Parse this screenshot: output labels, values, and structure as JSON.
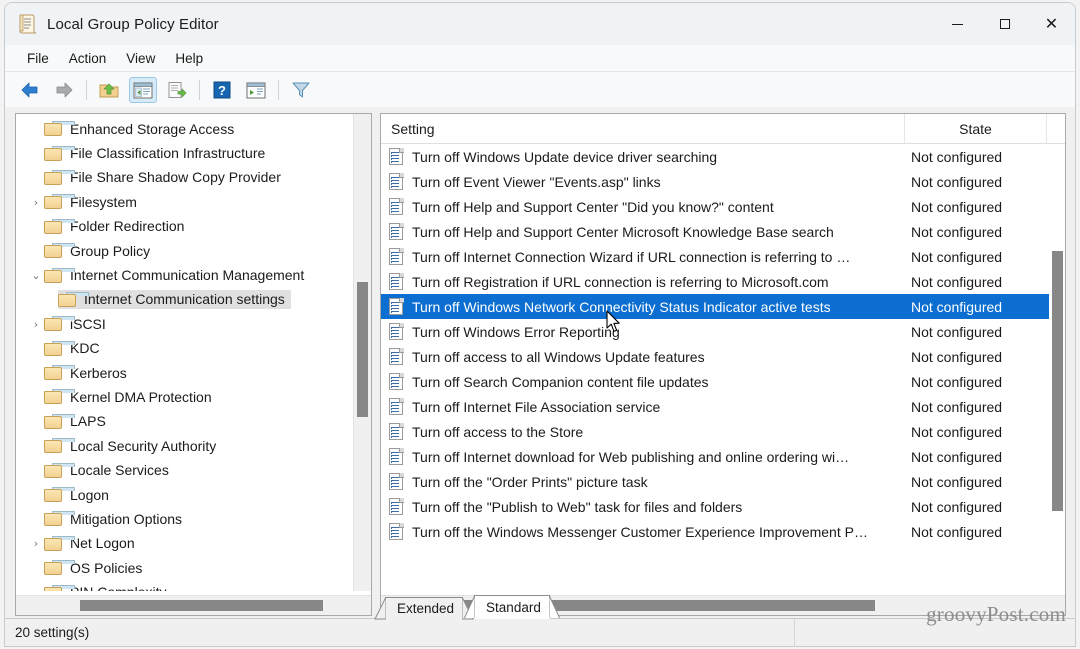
{
  "window": {
    "title": "Local Group Policy Editor",
    "icon": "group-policy-scroll-icon",
    "caption": {
      "minimize": "—",
      "maximize": "□",
      "close": "✕"
    }
  },
  "menubar": {
    "items": [
      {
        "label": "File"
      },
      {
        "label": "Action"
      },
      {
        "label": "View"
      },
      {
        "label": "Help"
      }
    ]
  },
  "toolbar": {
    "buttons": [
      {
        "name": "back-button",
        "icon": "back-arrow-icon"
      },
      {
        "name": "forward-button",
        "icon": "forward-arrow-icon"
      },
      {
        "name": "up-one-level-button",
        "icon": "up-folder-icon"
      },
      {
        "name": "show-hide-console-tree-button",
        "icon": "console-tree-icon",
        "pressed": true
      },
      {
        "name": "export-list-button",
        "icon": "export-list-icon"
      },
      {
        "name": "help-button",
        "icon": "help-question-icon"
      },
      {
        "name": "show-hide-action-pane-button",
        "icon": "action-pane-icon"
      },
      {
        "name": "filter-button",
        "icon": "filter-funnel-icon"
      }
    ]
  },
  "tree": {
    "nodes": [
      {
        "label": "Enhanced Storage Access",
        "chevron": "",
        "indent": 1
      },
      {
        "label": "File Classification Infrastructure",
        "chevron": "",
        "indent": 1
      },
      {
        "label": "File Share Shadow Copy Provider",
        "chevron": "",
        "indent": 1
      },
      {
        "label": "Filesystem",
        "chevron": "›",
        "indent": 1
      },
      {
        "label": "Folder Redirection",
        "chevron": "",
        "indent": 1
      },
      {
        "label": "Group Policy",
        "chevron": "",
        "indent": 1
      },
      {
        "label": "Internet Communication Management",
        "chevron": "⌄",
        "indent": 1
      },
      {
        "label": "Internet Communication settings",
        "chevron": "",
        "indent": 2,
        "selected": true
      },
      {
        "label": "iSCSI",
        "chevron": "›",
        "indent": 1
      },
      {
        "label": "KDC",
        "chevron": "",
        "indent": 1
      },
      {
        "label": "Kerberos",
        "chevron": "",
        "indent": 1
      },
      {
        "label": "Kernel DMA Protection",
        "chevron": "",
        "indent": 1
      },
      {
        "label": "LAPS",
        "chevron": "",
        "indent": 1
      },
      {
        "label": "Local Security Authority",
        "chevron": "",
        "indent": 1
      },
      {
        "label": "Locale Services",
        "chevron": "",
        "indent": 1
      },
      {
        "label": "Logon",
        "chevron": "",
        "indent": 1
      },
      {
        "label": "Mitigation Options",
        "chevron": "",
        "indent": 1
      },
      {
        "label": "Net Logon",
        "chevron": "›",
        "indent": 1
      },
      {
        "label": "OS Policies",
        "chevron": "",
        "indent": 1
      },
      {
        "label": "PIN Complexity",
        "chevron": "",
        "indent": 1
      }
    ]
  },
  "list": {
    "columns": [
      {
        "label": "Setting"
      },
      {
        "label": "State"
      }
    ],
    "rows": [
      {
        "setting": "Turn off Windows Update device driver searching",
        "state": "Not configured"
      },
      {
        "setting": "Turn off Event Viewer \"Events.asp\" links",
        "state": "Not configured"
      },
      {
        "setting": "Turn off Help and Support Center \"Did you know?\" content",
        "state": "Not configured"
      },
      {
        "setting": "Turn off Help and Support Center Microsoft Knowledge Base search",
        "state": "Not configured"
      },
      {
        "setting": "Turn off Internet Connection Wizard if URL connection is referring to …",
        "state": "Not configured"
      },
      {
        "setting": "Turn off Registration if URL connection is referring to Microsoft.com",
        "state": "Not configured"
      },
      {
        "setting": "Turn off Windows Network Connectivity Status Indicator active tests",
        "state": "Not configured",
        "selected": true
      },
      {
        "setting": "Turn off Windows Error Reporting",
        "state": "Not configured"
      },
      {
        "setting": "Turn off access to all Windows Update features",
        "state": "Not configured"
      },
      {
        "setting": "Turn off Search Companion content file updates",
        "state": "Not configured"
      },
      {
        "setting": "Turn off Internet File Association service",
        "state": "Not configured"
      },
      {
        "setting": "Turn off access to the Store",
        "state": "Not configured"
      },
      {
        "setting": "Turn off Internet download for Web publishing and online ordering wi…",
        "state": "Not configured"
      },
      {
        "setting": "Turn off the \"Order Prints\" picture task",
        "state": "Not configured"
      },
      {
        "setting": "Turn off the \"Publish to Web\" task for files and folders",
        "state": "Not configured"
      },
      {
        "setting": "Turn off the Windows Messenger Customer Experience Improvement P…",
        "state": "Not configured"
      }
    ]
  },
  "tabs": [
    {
      "label": "Extended",
      "active": false
    },
    {
      "label": "Standard",
      "active": true
    }
  ],
  "statusbar": {
    "text": "20 setting(s)"
  },
  "watermark": {
    "text": "groovyPost.com"
  },
  "colors": {
    "selection": "#0b6ed0",
    "window_bg": "#eff3f6",
    "pane_bg": "#ffffff",
    "scrollbar_thumb": "#878787",
    "folder": "#f2d192"
  }
}
